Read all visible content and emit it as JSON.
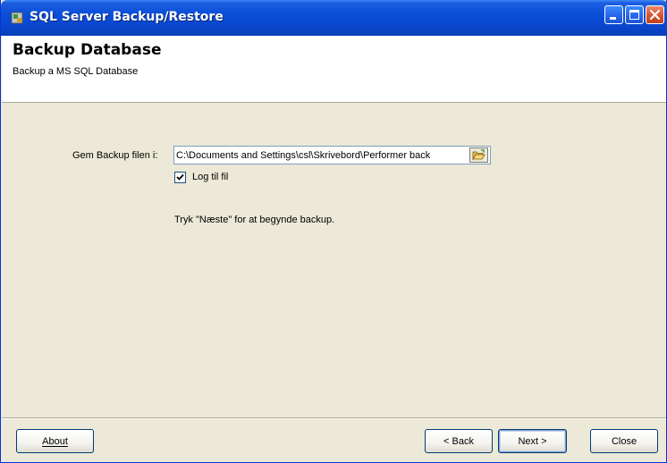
{
  "window": {
    "title": "SQL Server Backup/Restore",
    "title_icon": "app-icon",
    "controls": [
      "minimize-icon",
      "maximize-icon",
      "close-icon"
    ]
  },
  "header": {
    "title": "Backup Database",
    "subtitle": "Backup a MS SQL Database"
  },
  "form": {
    "save_label": "Gem Backup filen i:",
    "path_value": "C:\\Documents and Settings\\csl\\Skrivebord\\Performer back",
    "browse_icon": "folder-open-icon",
    "log_checkbox_checked": true,
    "log_label": "Log til fil",
    "instruction": "Tryk \"Næste\" for at begynde backup."
  },
  "footer": {
    "about_label": "About",
    "back_label": "< Back",
    "next_label": "Next >",
    "close_label": "Close"
  }
}
